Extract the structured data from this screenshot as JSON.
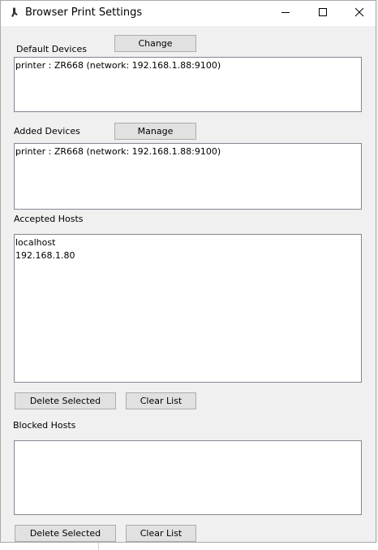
{
  "window": {
    "title": "Browser Print Settings",
    "icons": {
      "app": "app-icon",
      "minimize": "minimize-icon",
      "maximize": "maximize-icon",
      "close": "close-icon"
    }
  },
  "default_devices": {
    "label": "Default Devices",
    "button": "Change",
    "items": [
      "printer : ZR668 (network: 192.168.1.88:9100)"
    ]
  },
  "added_devices": {
    "label": "Added Devices",
    "button": "Manage",
    "items": [
      "printer : ZR668 (network: 192.168.1.88:9100)"
    ]
  },
  "accepted_hosts": {
    "label": "Accepted Hosts",
    "items": [
      "localhost",
      "192.168.1.80"
    ],
    "delete_button": "Delete Selected",
    "clear_button": "Clear List"
  },
  "blocked_hosts": {
    "label": "Blocked Hosts",
    "items": [],
    "delete_button": "Delete Selected",
    "clear_button": "Clear List"
  }
}
